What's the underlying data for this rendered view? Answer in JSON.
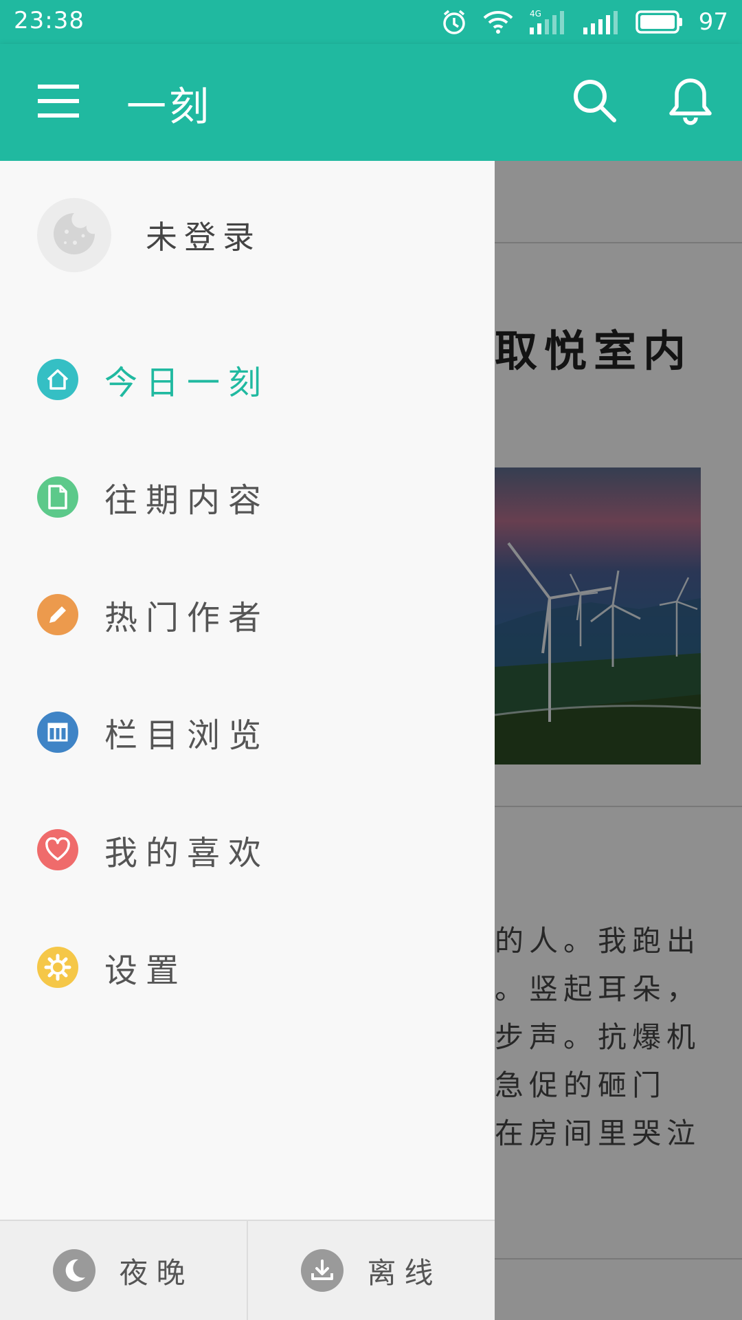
{
  "status_bar": {
    "time": "23:38",
    "battery": "97",
    "network": "4G"
  },
  "app_bar": {
    "title": "一刻"
  },
  "drawer": {
    "profile": {
      "name": "未登录"
    },
    "menu": [
      {
        "label": "今日一刻",
        "icon": "home-icon",
        "color": "#35bfc4",
        "active": true
      },
      {
        "label": "往期内容",
        "icon": "document-icon",
        "color": "#5cc98a",
        "active": false
      },
      {
        "label": "热门作者",
        "icon": "pencil-icon",
        "color": "#ec9a4d",
        "active": false
      },
      {
        "label": "栏目浏览",
        "icon": "columns-icon",
        "color": "#3f84c6",
        "active": false
      },
      {
        "label": "我的喜欢",
        "icon": "heart-icon",
        "color": "#ef6b6b",
        "active": false
      },
      {
        "label": "设置",
        "icon": "gear-icon",
        "color": "#f5c748",
        "active": false
      }
    ],
    "footer": {
      "night_label": "夜晚",
      "offline_label": "离线"
    }
  },
  "content": {
    "title_fragment": "取悦室内",
    "text_lines": [
      "的人。我跑出",
      "。竖起耳朵，",
      "步声。抗爆机",
      "急促的砸门",
      "在房间里哭泣"
    ]
  },
  "colors": {
    "accent": "#20b9a0"
  }
}
